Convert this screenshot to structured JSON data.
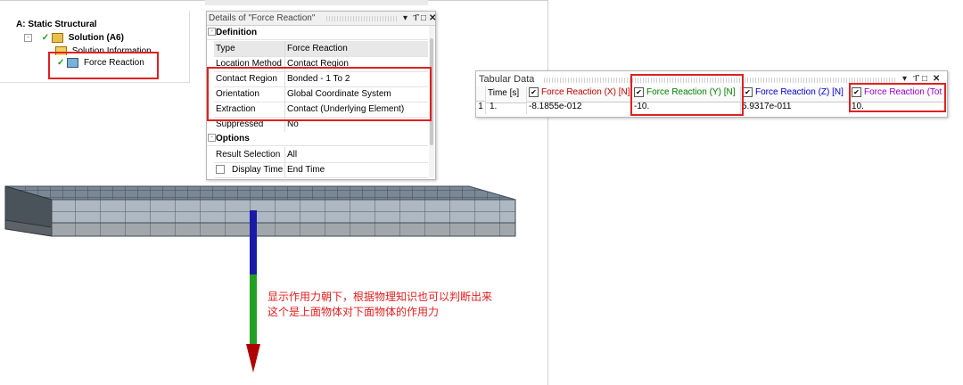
{
  "colors": {
    "highlight": "#e02020",
    "x_series": "#c00000",
    "y_series": "#008000",
    "z_series": "#0000cc",
    "total_series": "#9900cc",
    "arrow_head": "#b00000",
    "arrow_top": "#1a1aa8",
    "arrow_bottom": "#22a022"
  },
  "tree": {
    "title": "A: Static Structural",
    "solution": "Solution (A6)",
    "solution_info": "Solution Information",
    "force_reaction": "Force Reaction",
    "icons": [
      "minus-toggle-icon",
      "check-icon",
      "solution-icon",
      "solution-info-icon",
      "force-reaction-icon"
    ]
  },
  "details": {
    "title": "Details of \"Force Reaction\"",
    "icons": [
      "dropdown-icon",
      "pin-icon",
      "maximize-icon",
      "close-icon"
    ],
    "groups": {
      "definition": "Definition",
      "options": "Options"
    },
    "definition_rows": [
      {
        "key": "Type",
        "value": "Force Reaction"
      },
      {
        "key": "Location Method",
        "value": "Contact Region"
      },
      {
        "key": "Contact Region",
        "value": "Bonded - 1 To 2"
      },
      {
        "key": "Orientation",
        "value": "Global Coordinate System"
      },
      {
        "key": "Extraction",
        "value": "Contact (Underlying Element)"
      },
      {
        "key": "Suppressed",
        "value": "No"
      }
    ],
    "option_rows": [
      {
        "key": "Result Selection",
        "value": "All"
      },
      {
        "key": "Display Time",
        "value": "End Time"
      }
    ]
  },
  "tabular": {
    "title": "Tabular Data",
    "icons": [
      "dropdown-icon",
      "pin-icon",
      "maximize-icon",
      "close-icon"
    ],
    "headers": {
      "time": "Time [s]",
      "x": "Force Reaction (X) [N]",
      "y": "Force Reaction (Y) [N]",
      "z": "Force Reaction (Z) [N]",
      "total": "Force Reaction (Tot"
    },
    "row": {
      "index": "1",
      "time": "1.",
      "x": "-8.1855e-012",
      "y": "-10.",
      "z": "5.9317e-011",
      "total": "10."
    }
  },
  "annotation": {
    "line1": "显示作用力朝下，根据物理知识也可以判断出来",
    "line2": "这个是上面物体对下面物体的作用力"
  }
}
